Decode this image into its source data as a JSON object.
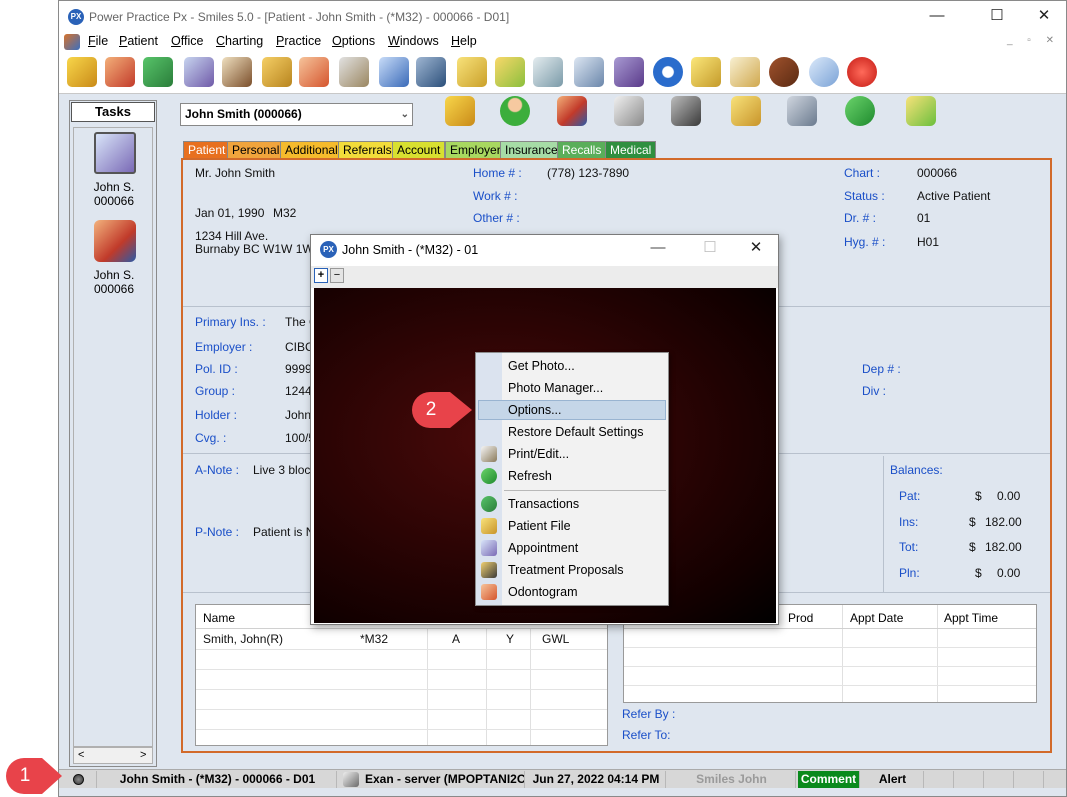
{
  "window": {
    "title": "Power Practice Px - Smiles 5.0 - [Patient - John Smith - (*M32) - 000066 - D01]",
    "icon_text": "PX",
    "minimize": "—",
    "maximize": "☐",
    "close": "✕"
  },
  "menu": [
    "File",
    "Patient",
    "Office",
    "Charting",
    "Practice",
    "Options",
    "Windows",
    "Help"
  ],
  "mdi_controls": "_ ▫ ✕",
  "tasks": {
    "header": "Tasks",
    "items": [
      {
        "label1": "John S.",
        "label2": "000066",
        "icon": "appointment-book-icon"
      },
      {
        "label1": "John S.",
        "label2": "000066",
        "icon": "patient-family-icon"
      }
    ],
    "scroll_left": "<",
    "scroll_right": ">"
  },
  "patient_select": {
    "value": "John Smith (000066)",
    "chevron": "⌄"
  },
  "tabs": [
    {
      "label": "Patient",
      "color": "#e8701e",
      "text": "#ffffff"
    },
    {
      "label": "Personal",
      "color": "#f0a43c",
      "text": "#000000"
    },
    {
      "label": "Additional",
      "color": "#f5bb2c",
      "text": "#000000"
    },
    {
      "label": "Referrals",
      "color": "#f2dc3a",
      "text": "#000000"
    },
    {
      "label": "Account",
      "color": "#d8e030",
      "text": "#000000"
    },
    {
      "label": "Employer",
      "color": "#a8d860",
      "text": "#000000"
    },
    {
      "label": "Insurance",
      "color": "#a6dca6",
      "text": "#000000"
    },
    {
      "label": "Recalls",
      "color": "#5aae5a",
      "text": "#ffffff"
    },
    {
      "label": "Medical",
      "color": "#2f8f3f",
      "text": "#ffffff"
    }
  ],
  "patient": {
    "name_line": "Mr. John Smith",
    "dob": "Jan 01, 1990",
    "code": "M32",
    "address1": "1234 Hill Ave.",
    "address2": "Burnaby  BC  W1W 1W1",
    "home_label": "Home # :",
    "home_value": "(778) 123-7890",
    "work_label": "Work # :",
    "other_label": "Other # :",
    "chart_label": "Chart :",
    "chart_value": "000066",
    "status_label": "Status :",
    "status_value": "Active Patient",
    "dr_label": "Dr. # :",
    "dr_value": "01",
    "hyg_label": "Hyg. # :",
    "hyg_value": "H01"
  },
  "insurance": {
    "primary_label": "Primary Ins. :",
    "primary_value": "The C",
    "employer_label": "Employer :",
    "employer_value": "CIBC",
    "pol_label": "Pol. ID :",
    "pol_value": "99999",
    "group_label": "Group :",
    "group_value": "1244",
    "holder_label": "Holder :",
    "holder_value": "John",
    "cvg_label": "Cvg. :",
    "cvg_value": "100/5",
    "dep_label": "Dep # :",
    "div_label": "Div :"
  },
  "notes": {
    "anote_label": "A-Note :",
    "anote_value": "Live 3 block",
    "pnote_label": "P-Note :",
    "pnote_value": "Patient is Ne"
  },
  "balances": {
    "title": "Balances:",
    "rows": [
      {
        "label": "Pat:",
        "currency": "$",
        "amount": "0.00"
      },
      {
        "label": "Ins:",
        "currency": "$",
        "amount": "182.00"
      },
      {
        "label": "Tot:",
        "currency": "$",
        "amount": "182.00"
      },
      {
        "label": "Pln:",
        "currency": "$",
        "amount": "0.00"
      }
    ]
  },
  "family_grid": {
    "col_name": "Name",
    "row": {
      "name": "Smith, John(R)",
      "code": "*M32",
      "a": "A",
      "y": "Y",
      "gwl": "GWL"
    }
  },
  "appt_grid": {
    "col_prod": "Prod",
    "col_date": "Appt Date",
    "col_time": "Appt Time",
    "refer_by": "Refer By :",
    "refer_to": "Refer To:"
  },
  "statusbar": {
    "patient": "John Smith - (*M32) - 000066 - D01",
    "server": "Exan - server (MPOPTANI2C",
    "datetime": "Jun 27, 2022  04:14 PM",
    "user": "Smiles John",
    "comment": "Comment",
    "alert": "Alert",
    "comment_color": "#0a8a1c"
  },
  "photo_window": {
    "title": "John Smith - (*M32) - 01",
    "plus": "+",
    "minus": "−",
    "minimize": "—",
    "maximize": "☐",
    "close": "✕"
  },
  "context_menu": {
    "items": [
      {
        "label": "Get Photo...",
        "icon": ""
      },
      {
        "label": "Photo Manager...",
        "icon": ""
      },
      {
        "label": "Options...",
        "icon": "",
        "highlighted": true
      },
      {
        "label": "Restore Default Settings",
        "icon": ""
      },
      {
        "label": "Print/Edit...",
        "icon": "print-edit-icon"
      },
      {
        "label": "Refresh",
        "icon": "refresh-icon"
      },
      {
        "label": "Transactions",
        "icon": "transactions-icon"
      },
      {
        "label": "Patient File",
        "icon": "patient-file-icon"
      },
      {
        "label": "Appointment",
        "icon": "appointment-icon"
      },
      {
        "label": "Treatment Proposals",
        "icon": "treatment-proposals-icon"
      },
      {
        "label": "Odontogram",
        "icon": "odontogram-icon"
      }
    ]
  },
  "callouts": {
    "one": "1",
    "two": "2",
    "color": "#e8434a"
  }
}
